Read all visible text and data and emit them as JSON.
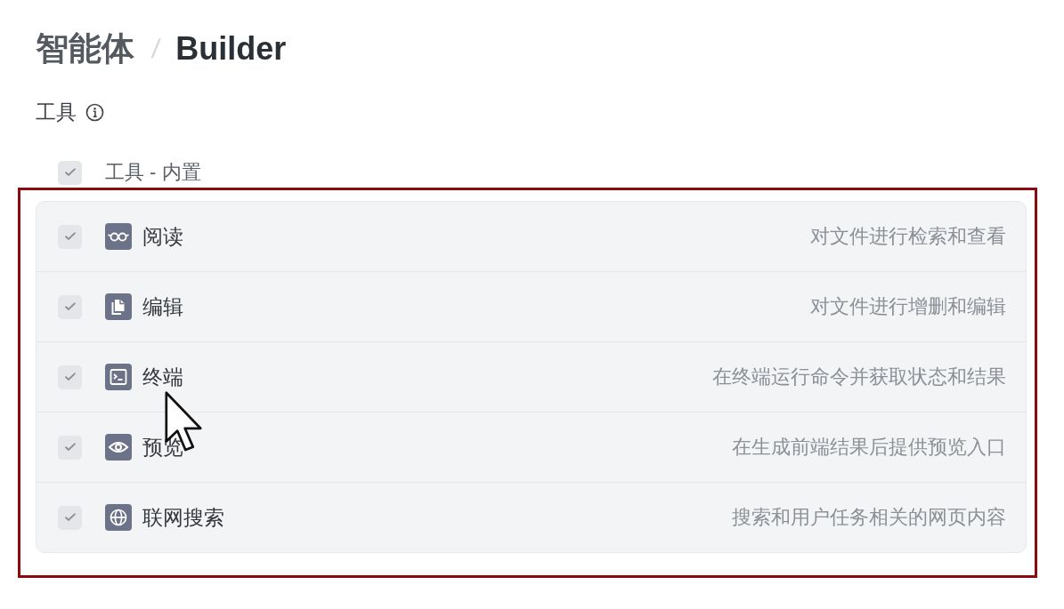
{
  "breadcrumb": {
    "items": [
      {
        "label": "智能体",
        "current": false
      },
      {
        "label": "Builder",
        "current": true
      }
    ],
    "separator": "/"
  },
  "tools_section": {
    "title": "工具",
    "highlighted": true,
    "group": {
      "label": "工具 - 内置",
      "checked": true,
      "disabled": true
    },
    "tools": [
      {
        "kind": "read",
        "name": "阅读",
        "description": "对文件进行检索和查看",
        "checked": true,
        "disabled": true
      },
      {
        "kind": "edit",
        "name": "编辑",
        "description": "对文件进行增删和编辑",
        "checked": true,
        "disabled": true
      },
      {
        "kind": "terminal",
        "name": "终端",
        "description": "在终端运行命令并获取状态和结果",
        "checked": true,
        "disabled": true
      },
      {
        "kind": "preview",
        "name": "预览",
        "description": "在生成前端结果后提供预览入口",
        "checked": true,
        "disabled": true
      },
      {
        "kind": "search",
        "name": "联网搜索",
        "description": "搜索和用户任务相关的网页内容",
        "checked": true,
        "disabled": true
      }
    ]
  },
  "cursor": {
    "kind": "arrow"
  }
}
